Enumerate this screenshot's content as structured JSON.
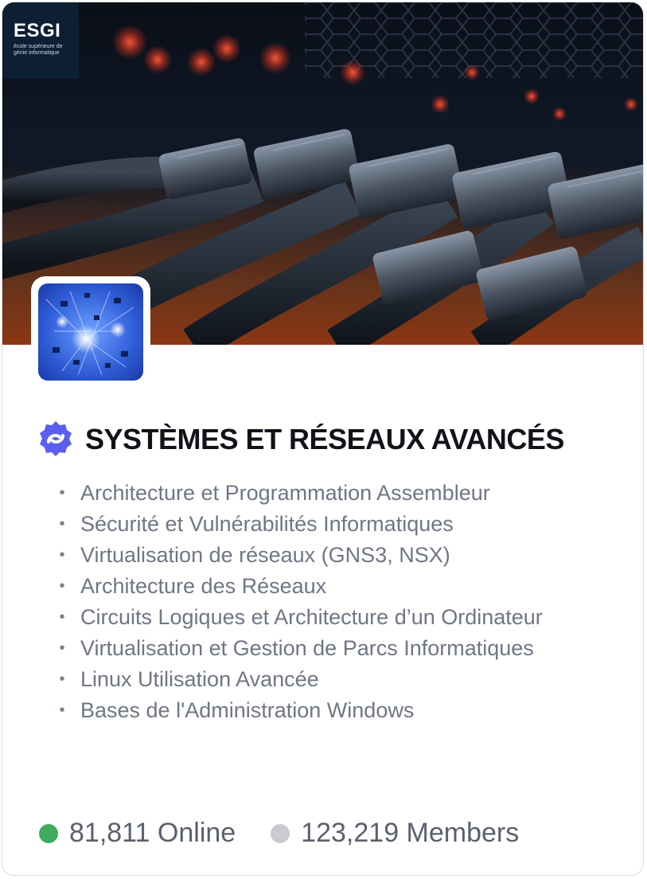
{
  "brand": {
    "name": "ESGI",
    "tagline": "école supérieure de génie informatique"
  },
  "title": "SYSTÈMES ET RÉSEAUX AVANCÉS",
  "topics": [
    "Architecture et Programmation Assembleur",
    "Sécurité et Vulnérabilités Informatiques",
    "Virtualisation de réseaux (GNS3, NSX)",
    "Architecture des Réseaux",
    "Circuits Logiques et Architecture d’un Ordinateur",
    "Virtualisation et Gestion de Parcs Informatiques",
    "Linux Utilisation Avancée",
    "Bases de l'Administration Windows"
  ],
  "stats": {
    "online": "81,811 Online",
    "members": "123,219 Members"
  },
  "colors": {
    "online_dot": "#3fab5a",
    "members_dot": "#c9cbcf",
    "badge": "#5b5ff0",
    "title": "#111319",
    "topic_text": "#6f7684"
  },
  "icons": {
    "verified": "verified-badge-icon",
    "bullet": "bullet-icon"
  }
}
